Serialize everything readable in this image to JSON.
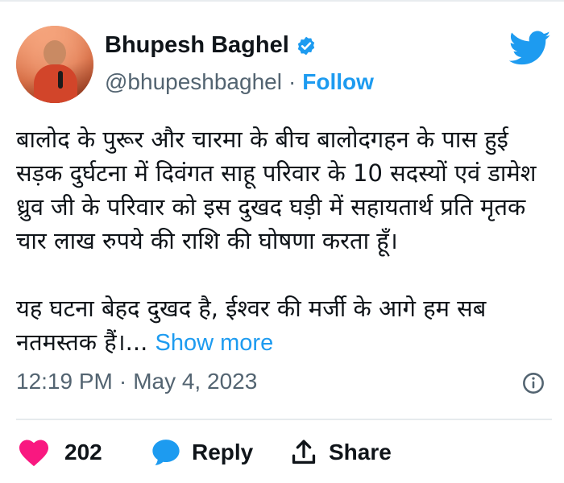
{
  "author": {
    "name": "Bhupesh Baghel",
    "handle": "@bhupeshbaghel",
    "separator": "·",
    "follow_label": "Follow"
  },
  "tweet": {
    "paragraph1": "बालोद के पुरूर और चारमा के बीच बालोदगहन के पास हुई सड़क दुर्घटना में दिवंगत साहू परिवार के 10 सदस्यों एवं डामेश ध्रुव जी के परिवार को इस दुखद घड़ी में सहायतार्थ प्रति मृतक चार लाख रुपये की राशि की घोषणा करता हूँ।",
    "paragraph2": "यह घटना बेहद दुखद है, ईश्वर की मर्जी के आगे हम सब नतमस्तक हैं।...",
    "show_more_label": "Show more"
  },
  "meta": {
    "time": "12:19 PM",
    "separator": "·",
    "date": "May 4, 2023"
  },
  "actions": {
    "like_count": "202",
    "reply_label": "Reply",
    "share_label": "Share"
  },
  "icons": {
    "verified": "verified-badge-icon",
    "logo": "twitter-bird-icon",
    "info": "info-icon",
    "like": "heart-icon",
    "reply": "speech-bubble-icon",
    "share": "share-arrow-icon"
  },
  "colors": {
    "accent": "#1d9bf0",
    "like": "#f91880",
    "secondary_text": "#536471",
    "primary_text": "#0f1419"
  }
}
